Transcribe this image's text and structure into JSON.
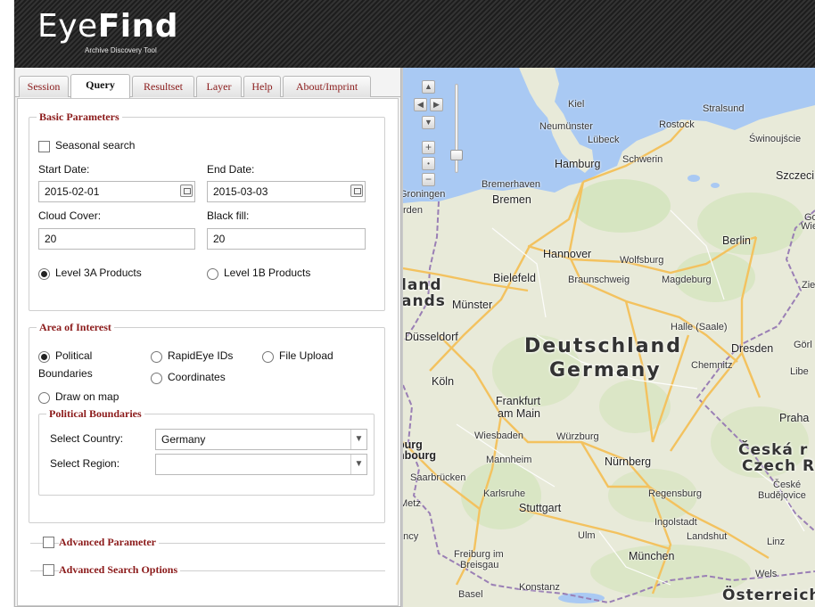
{
  "app": {
    "title_light": "Eye",
    "title_bold": "Find",
    "subtitle": "Archive Discovery Tool"
  },
  "tabs": [
    {
      "label": "Session",
      "active": false
    },
    {
      "label": "Query",
      "active": true
    },
    {
      "label": "Resultset",
      "active": false
    },
    {
      "label": "Layer",
      "active": false
    },
    {
      "label": "Help",
      "active": false
    },
    {
      "label": "About/Imprint",
      "active": false
    }
  ],
  "basic": {
    "legend": "Basic Parameters",
    "seasonal_label": "Seasonal search",
    "seasonal_checked": false,
    "start_label": "Start Date:",
    "start_value": "2015-02-01",
    "end_label": "End Date:",
    "end_value": "2015-03-03",
    "cloud_label": "Cloud Cover:",
    "cloud_value": "20",
    "black_label": "Black fill:",
    "black_value": "20",
    "level3a_label": "Level 3A Products",
    "level3a_selected": true,
    "level1b_label": "Level 1B Products",
    "level1b_selected": false
  },
  "aoi": {
    "legend": "Area of Interest",
    "political_label_1": "Political",
    "political_label_2": "Boundaries",
    "political_selected": true,
    "rapideye_label": "RapidEye IDs",
    "file_label": "File Upload",
    "coords_label": "Coordinates",
    "draw_label": "Draw on map",
    "pb_legend": "Political Boundaries",
    "country_label": "Select Country:",
    "country_value": "Germany",
    "region_label": "Select Region:",
    "region_value": ""
  },
  "advanced": {
    "param_label": "Advanced Parameter",
    "search_label": "Advanced Search Options"
  },
  "map": {
    "country_de": "Deutschland",
    "country_en": "Germany",
    "cz_1": "Česká r",
    "cz_2": "Czech R",
    "at": "Österreich",
    "nl_1": "land",
    "nl_2": "ands",
    "cities": {
      "kiel": "Kiel",
      "stralsund": "Stralsund",
      "neumunster": "Neumünster",
      "rostock": "Rostock",
      "lubeck": "Lübeck",
      "swinoujscie": "Świnoujście",
      "hamburg": "Hamburg",
      "schwerin": "Schwerin",
      "szczecin": "Szczecin",
      "groningen": "Groningen",
      "bremerhaven": "Bremerhaven",
      "bremen": "Bremen",
      "rden": "rden",
      "go": "Go",
      "wielk": "Wielk",
      "berlin": "Berlin",
      "hannover": "Hannover",
      "wolfsburg": "Wolfsburg",
      "bielefeld": "Bielefeld",
      "braunschweig": "Braunschweig",
      "magdeburg": "Magdeburg",
      "zie": "Zie",
      "munster": "Münster",
      "halle": "Halle (Saale)",
      "dusseldorf": "Düsseldorf",
      "dresden": "Dresden",
      "gorl": "Görl",
      "chemnitz": "Chemnitz",
      "libe": "Libe",
      "koln": "Köln",
      "frankfurt": "Frankfurt",
      "ammain": "am Main",
      "praha": "Praha",
      "wiesbaden": "Wiesbaden",
      "wurzburg": "Würzburg",
      "lburg": "burg",
      "nbourg": "nbourg",
      "mannheim": "Mannheim",
      "nurnberg": "Nürnberg",
      "saarbrucken": "Saarbrücken",
      "karlsruhe": "Karlsruhe",
      "regensburg": "Regensburg",
      "ceske": "České",
      "budejovice": "Budějovice",
      "metz": "Metz",
      "stuttgart": "Stuttgart",
      "ingolstadt": "Ingolstadt",
      "ancy": "ancy",
      "ulm": "Ulm",
      "landshut": "Landshut",
      "linz": "Linz",
      "freiburg": "Freiburg im",
      "breisgau": "Breisgau",
      "munchen": "München",
      "wels": "Wels",
      "basel": "Basel",
      "konstanz": "Konstanz"
    }
  }
}
